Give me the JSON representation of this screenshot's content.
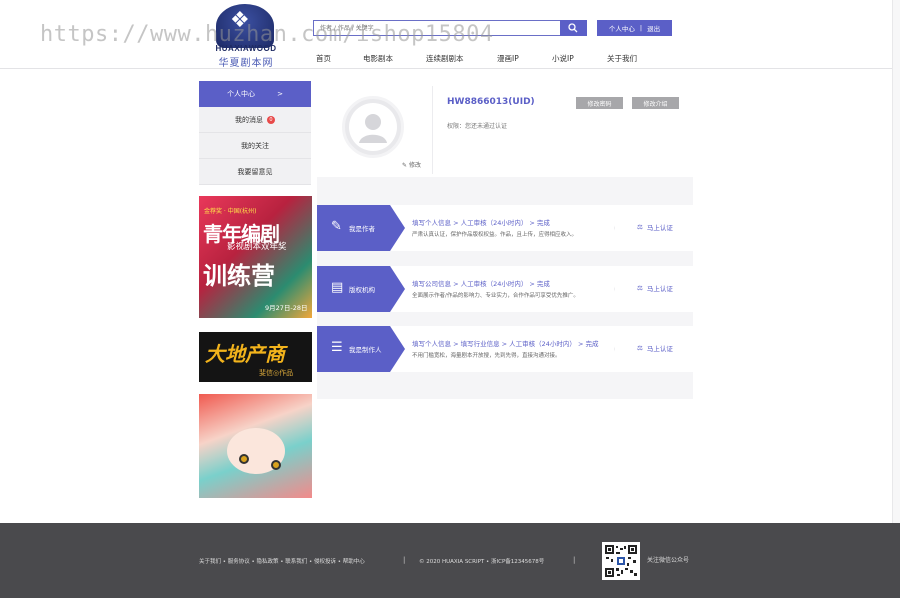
{
  "header": {
    "logo_en": "HUAXIAWOOD",
    "logo_cn": "华夏剧本网",
    "search_placeholder": "作者 / 作品 / 关键字",
    "user_center": "个人中心",
    "divider": "|",
    "logout": "退出",
    "nav": [
      "首页",
      "电影剧本",
      "连续剧剧本",
      "漫画IP",
      "小说IP",
      "关于我们"
    ]
  },
  "watermark": "https://www.huzhan.com/ishop15804",
  "sidebar": {
    "head_label": "个人中心",
    "head_arrow": ">",
    "items": [
      {
        "label": "我的消息",
        "badge": "0"
      },
      {
        "label": "我的关注"
      },
      {
        "label": "我要留意见"
      }
    ]
  },
  "ads": {
    "ad1": {
      "line1": "金荐奖 · 中国(杭州)",
      "line2": "青年编剧",
      "line3": "影视剧本双年奖",
      "line4": "训练营",
      "date": "9月27日-28日"
    },
    "ad2": {
      "title": "大地产商",
      "sub": "斐信◎作品"
    },
    "ad3": {}
  },
  "profile": {
    "uid": "HW8866013(UID)",
    "auth_status": "权限：您还未通过认证",
    "edit_label": "修改",
    "btn_password": "修改密码",
    "btn_intro": "修改介绍"
  },
  "rows": [
    {
      "label": "我是作者",
      "icon": "pencil-icon",
      "steps": "填写个人信息 > 人工审核（24小时内） > 完成",
      "desc": "严肃认真认证，保护作品版权权益。作品，且上传，应得相应收入。",
      "cta": "马上认证"
    },
    {
      "label": "版权机构",
      "icon": "document-icon",
      "steps": "填写公司信息 > 人工审核（24小时内） > 完成",
      "desc": "全面展示作者/作品的影响力、专业实力，合作作品可享受优先推广。",
      "cta": "马上认证"
    },
    {
      "label": "我是制作人",
      "icon": "list-icon",
      "steps": "填写个人信息 > 填写行业信息 > 人工审核（24小时内） > 完成",
      "desc": "不用门槛宽松，海量剧本开放搜，先到先得，直接沟通对接。",
      "cta": "马上认证"
    }
  ],
  "footer": {
    "links": "关于我们 • 服务协议 • 隐私政策 • 联系我们 • 侵权投诉 • 帮助中心",
    "sep": "|",
    "copyright": "© 2020 HUAXIA SCRIPT • 浙ICP备12345678号",
    "qr_text": "关注微信公众号"
  },
  "colors": {
    "accent": "#5b5fc7",
    "footer_bg": "#4a4a4d",
    "panel_bg": "#f5f5f7"
  }
}
